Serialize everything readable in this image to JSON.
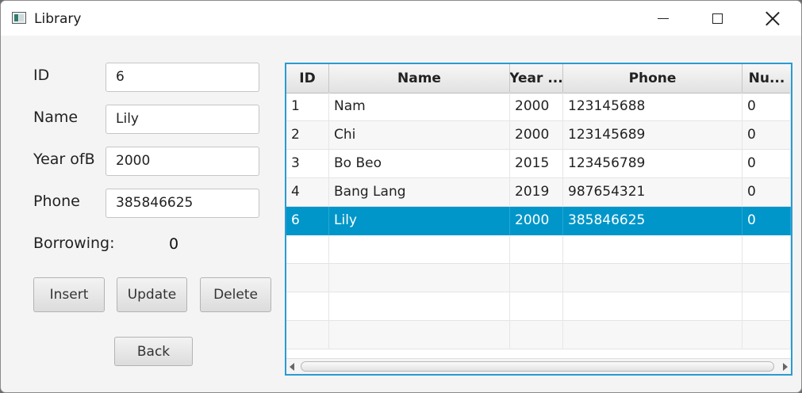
{
  "window": {
    "title": "Library",
    "controls": {
      "minimize": "minimize",
      "maximize": "maximize",
      "close": "close"
    }
  },
  "form": {
    "id_label": "ID",
    "id_value": "6",
    "name_label": "Name",
    "name_value": "Lily",
    "year_label": "Year ofB",
    "year_value": "2000",
    "phone_label": "Phone",
    "phone_value": "385846625",
    "borrowing_label": "Borrowing:",
    "borrowing_value": "0"
  },
  "buttons": {
    "insert": "Insert",
    "update": "Update",
    "delete": "Delete",
    "back": "Back"
  },
  "table": {
    "columns": [
      "ID",
      "Name",
      "Year ...",
      "Phone",
      "Nu..."
    ],
    "rows": [
      [
        "1",
        "Nam",
        "2000",
        "123145688",
        "0"
      ],
      [
        "2",
        "Chi",
        "2000",
        "123145689",
        "0"
      ],
      [
        "3",
        "Bo Beo",
        "2015",
        "123456789",
        "0"
      ],
      [
        "4",
        "Bang Lang",
        "2019",
        "987654321",
        "0"
      ],
      [
        "6",
        "Lily",
        "2000",
        "385846625",
        "0"
      ]
    ],
    "selected_row": 4,
    "selection_color": "#0096c9",
    "focus_color": "#2a9bd3"
  }
}
